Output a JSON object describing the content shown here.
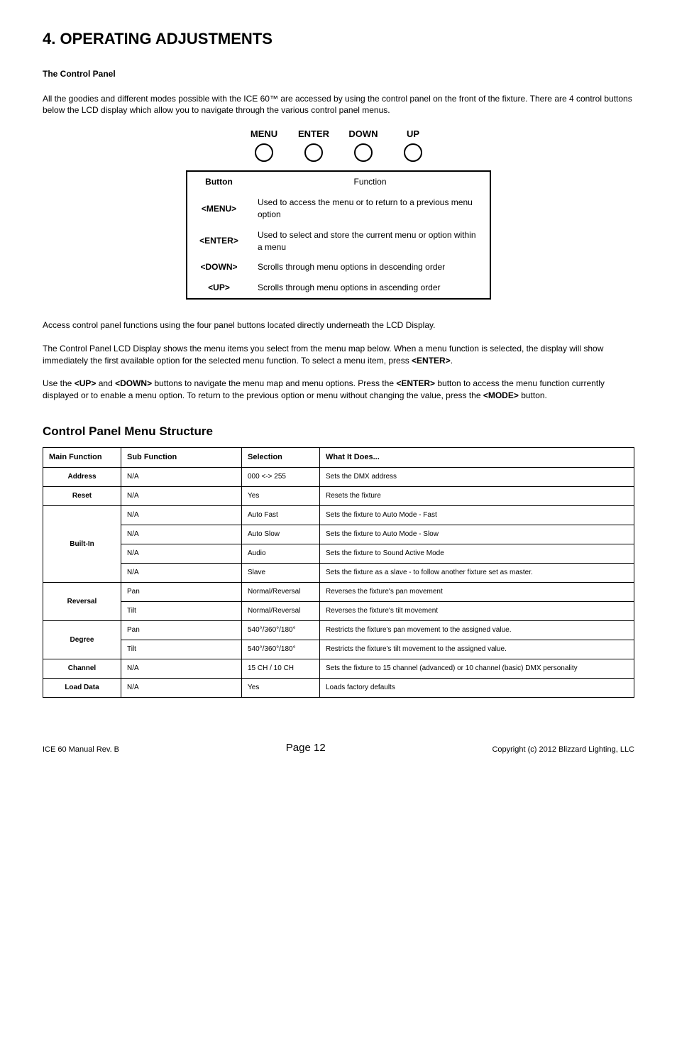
{
  "heading": "4. OPERATING ADJUSTMENTS",
  "sub_heading": "The Control Panel",
  "intro": "All the goodies and different modes possible with the ICE 60™ are accessed by using the control panel on the front of the fixture.  There are 4 control buttons below the LCD display which allow you to navigate through the various control panel menus.",
  "panel_buttons": [
    "MENU",
    "ENTER",
    "DOWN",
    "UP"
  ],
  "func_table": {
    "head": [
      "Button",
      "Function"
    ],
    "rows": [
      [
        "<MENU>",
        "Used to access the menu or to return to a previous menu option"
      ],
      [
        "<ENTER>",
        "Used to select and store the current menu or option within a menu"
      ],
      [
        "<DOWN>",
        "Scrolls through menu options in descending order"
      ],
      [
        "<UP>",
        "Scrolls through menu options in ascending order"
      ]
    ]
  },
  "para2": "Access control panel functions using the four panel buttons located directly underneath the LCD Display.",
  "para3_a": "The Control Panel LCD Display shows the menu items you select from the menu map below. When a menu function is selected, the display will show immediately the first available option for the selected menu function. To select a menu item, press ",
  "para3_b": "<ENTER>",
  "para3_c": ".",
  "para4_1": "Use the ",
  "para4_2": "<UP>",
  "para4_3": " and ",
  "para4_4": "<DOWN>",
  "para4_5": " buttons to navigate the menu map and menu options. Press the ",
  "para4_6": "<ENTER>",
  "para4_7": " button to access the menu function currently displayed or to enable a menu option. To return to the previous option or menu without changing the value, press the ",
  "para4_8": "<MODE>",
  "para4_9": " button.",
  "menu_heading": "Control Panel Menu Structure",
  "menu_table": {
    "head": [
      "Main Function",
      "Sub Function",
      "Selection",
      "What It Does..."
    ],
    "groups": [
      {
        "main": "Address",
        "rows": [
          [
            "N/A",
            "000 <-> 255",
            "Sets the DMX address"
          ]
        ]
      },
      {
        "main": "Reset",
        "rows": [
          [
            "N/A",
            "Yes",
            "Resets the fixture"
          ]
        ]
      },
      {
        "main": "Built-In",
        "rows": [
          [
            "N/A",
            "Auto Fast",
            "Sets the fixture to Auto Mode - Fast"
          ],
          [
            "N/A",
            "Auto Slow",
            "Sets the fixture to Auto Mode - Slow"
          ],
          [
            "N/A",
            "Audio",
            "Sets the fixture to Sound Active Mode"
          ],
          [
            "N/A",
            "Slave",
            "Sets the fixture as a slave - to follow another fixture set as master."
          ]
        ]
      },
      {
        "main": "Reversal",
        "rows": [
          [
            "Pan",
            "Normal/Reversal",
            "Reverses the fixture's pan movement"
          ],
          [
            "Tilt",
            "Normal/Reversal",
            "Reverses the fixture's tilt movement"
          ]
        ]
      },
      {
        "main": "Degree",
        "rows": [
          [
            "Pan",
            "540°/360°/180°",
            "Restricts the fixture's pan movement to the assigned value."
          ],
          [
            "Tilt",
            "540°/360°/180°",
            "Restricts the fixture's tilt movement to the assigned value."
          ]
        ]
      },
      {
        "main": "Channel",
        "rows": [
          [
            "N/A",
            "15 CH / 10 CH",
            "Sets the fixture to 15 channel (advanced) or 10 channel (basic) DMX personality"
          ]
        ]
      },
      {
        "main": "Load Data",
        "rows": [
          [
            "N/A",
            "Yes",
            "Loads factory defaults"
          ]
        ]
      }
    ]
  },
  "footer": {
    "left": "ICE 60 Manual Rev. B",
    "center": "Page 12",
    "right": "Copyright (c) 2012 Blizzard Lighting, LLC"
  }
}
